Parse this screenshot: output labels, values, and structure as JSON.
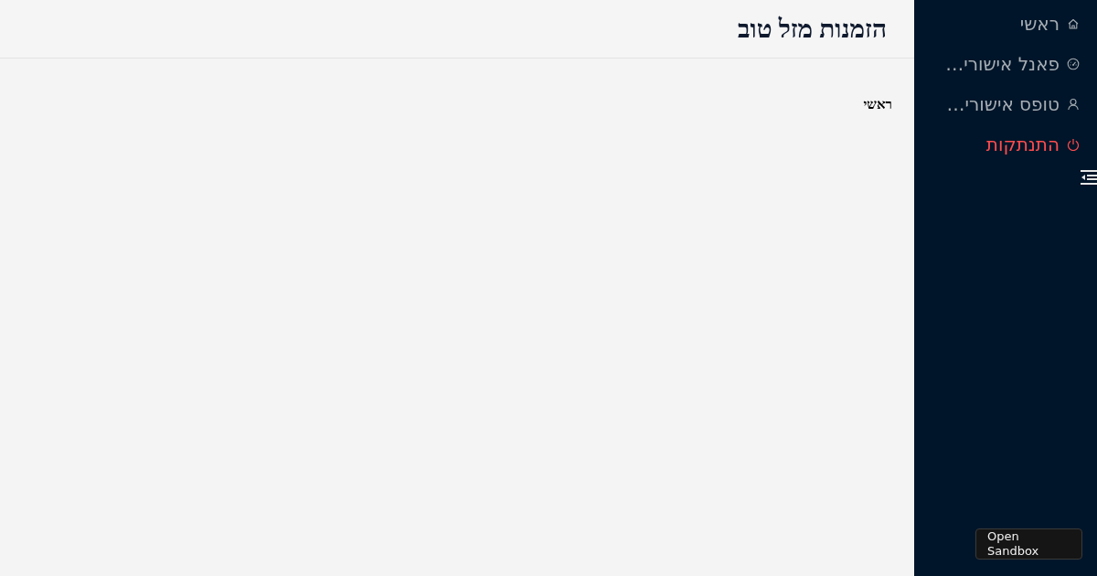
{
  "header": {
    "title": "הזמנות מזל טוב"
  },
  "breadcrumb": [
    {
      "label": "ראשי"
    }
  ],
  "sidebar": {
    "items": [
      {
        "label": "ראשי",
        "kind": "home"
      },
      {
        "label": "פאנל אישורי…",
        "kind": "dashboard"
      },
      {
        "label": "טופס אישורי…",
        "kind": "user"
      },
      {
        "label": "התנתקות",
        "kind": "logout"
      }
    ]
  },
  "sandbox_button": {
    "label": "Open Sandbox"
  }
}
